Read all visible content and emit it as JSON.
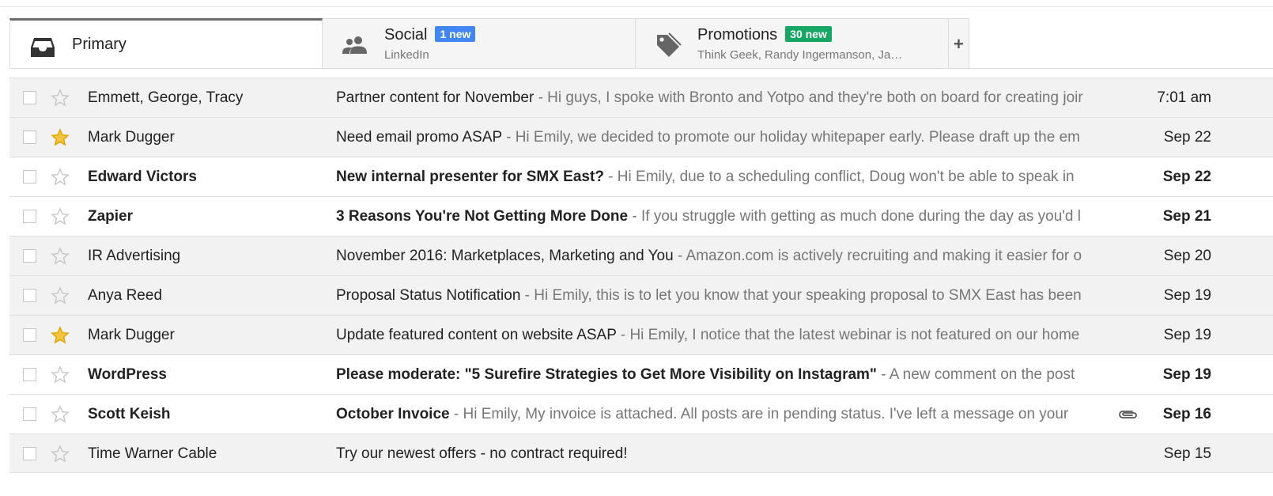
{
  "tabs": [
    {
      "key": "primary",
      "label": "Primary",
      "icon": "inbox-icon"
    },
    {
      "key": "social",
      "label": "Social",
      "badge": "1 new",
      "badge_color": "#4285f4",
      "sub": "LinkedIn",
      "icon": "people-icon"
    },
    {
      "key": "promotions",
      "label": "Promotions",
      "badge": "30 new",
      "badge_color": "#16a765",
      "sub": "Think Geek, Randy Ingermanson, Ja…",
      "icon": "tag-icon"
    }
  ],
  "add_tab_label": "+",
  "colors": {
    "star_on": "#f4c542",
    "star_off": "#c8c8c8"
  },
  "emails": [
    {
      "sender": "Emmett, George, Tracy",
      "subject": "Partner content for November",
      "snippet": " - Hi guys, I spoke with Bronto and Yotpo and they're both on board for creating joir",
      "date": "7:01 am",
      "starred": false,
      "unread": false,
      "attachment": false
    },
    {
      "sender": "Mark Dugger",
      "subject": "Need email promo ASAP",
      "snippet": " - Hi Emily, we decided to promote our holiday whitepaper early. Please draft up the em",
      "date": "Sep 22",
      "starred": true,
      "unread": false,
      "attachment": false
    },
    {
      "sender": "Edward Victors",
      "subject": "New internal presenter for SMX East?",
      "snippet": " - Hi Emily, due to a scheduling conflict, Doug won't be able to speak in",
      "date": "Sep 22",
      "starred": false,
      "unread": true,
      "attachment": false
    },
    {
      "sender": "Zapier",
      "subject": "3 Reasons You're Not Getting More Done",
      "snippet": " - If you struggle with getting as much done during the day as you'd l",
      "date": "Sep 21",
      "starred": false,
      "unread": true,
      "attachment": false
    },
    {
      "sender": "IR Advertising",
      "subject": "November 2016: Marketplaces, Marketing and You",
      "snippet": " - Amazon.com is actively recruiting and making it easier for o",
      "date": "Sep 20",
      "starred": false,
      "unread": false,
      "attachment": false
    },
    {
      "sender": "Anya Reed",
      "subject": "Proposal Status Notification",
      "snippet": " - Hi Emily, this is to let you know that your speaking proposal to SMX East has been",
      "date": "Sep 19",
      "starred": false,
      "unread": false,
      "attachment": false
    },
    {
      "sender": "Mark Dugger",
      "subject": "Update featured content on website ASAP",
      "snippet": " - Hi Emily, I notice that the latest webinar is not featured on our home",
      "date": "Sep 19",
      "starred": true,
      "unread": false,
      "attachment": false
    },
    {
      "sender": "WordPress",
      "subject": "Please moderate: \"5 Surefire Strategies to Get More Visibility on Instagram\"",
      "snippet": " - A new comment on the post",
      "date": "Sep 19",
      "starred": false,
      "unread": true,
      "attachment": false
    },
    {
      "sender": "Scott Keish",
      "subject": "October Invoice",
      "snippet": " - Hi Emily,  My invoice is attached. All posts are in pending status. I've left a message on your",
      "date": "Sep 16",
      "starred": false,
      "unread": true,
      "attachment": true
    },
    {
      "sender": "Time Warner Cable",
      "subject": "Try our newest offers - no contract required!",
      "snippet": "",
      "date": "Sep 15",
      "starred": false,
      "unread": false,
      "attachment": false
    }
  ]
}
